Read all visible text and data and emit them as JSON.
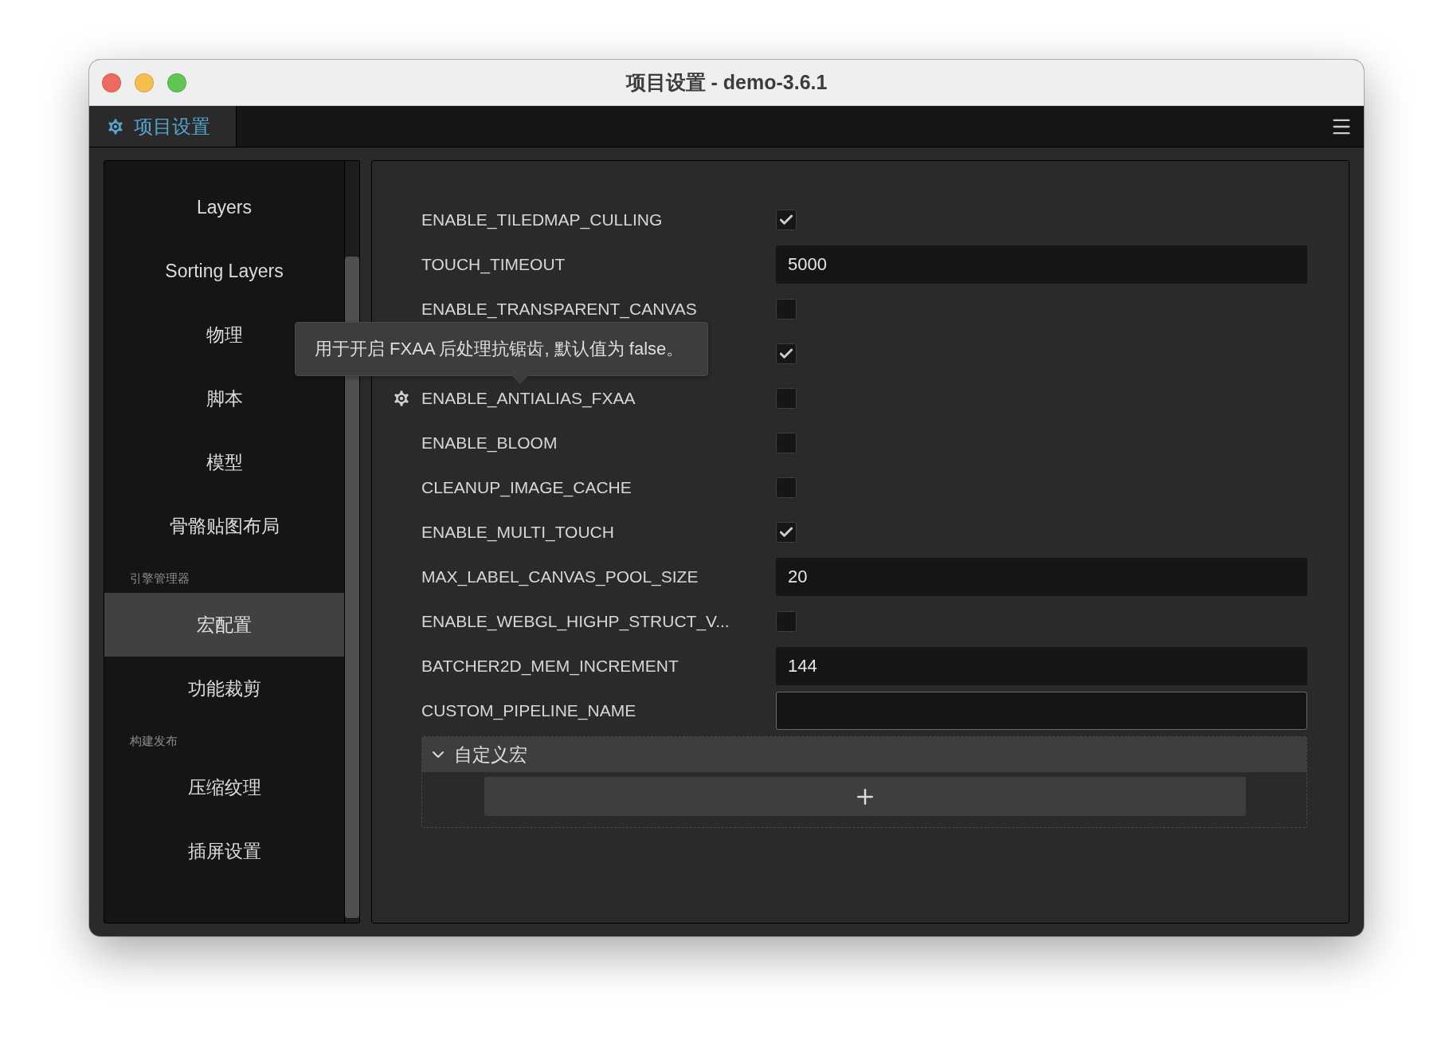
{
  "window": {
    "title": "项目设置 - demo-3.6.1"
  },
  "tabs": [
    {
      "label": "项目设置",
      "selected": true
    }
  ],
  "sidebar": {
    "items": [
      {
        "kind": "item",
        "label": "Layers",
        "selected": false
      },
      {
        "kind": "item",
        "label": "Sorting Layers",
        "selected": false
      },
      {
        "kind": "item",
        "label": "物理",
        "selected": false
      },
      {
        "kind": "item",
        "label": "脚本",
        "selected": false
      },
      {
        "kind": "item",
        "label": "模型",
        "selected": false
      },
      {
        "kind": "item",
        "label": "骨骼贴图布局",
        "selected": false
      },
      {
        "kind": "header",
        "label": "引擎管理器"
      },
      {
        "kind": "item",
        "label": "宏配置",
        "selected": true
      },
      {
        "kind": "item",
        "label": "功能裁剪",
        "selected": false
      },
      {
        "kind": "header",
        "label": "构建发布"
      },
      {
        "kind": "item",
        "label": "压缩纹理",
        "selected": false
      },
      {
        "kind": "item",
        "label": "插屏设置",
        "selected": false
      }
    ]
  },
  "settings": [
    {
      "kind": "checkbox",
      "label": "ENABLE_TILEDMAP_CULLING",
      "checked": true,
      "hovered": false
    },
    {
      "kind": "text",
      "label": "TOUCH_TIMEOUT",
      "value": "5000",
      "hovered": false
    },
    {
      "kind": "checkbox",
      "label": "ENABLE_TRANSPARENT_CANVAS",
      "checked": false,
      "hovered": false
    },
    {
      "kind": "checkbox",
      "checked": true,
      "hovered": false
    },
    {
      "kind": "checkbox",
      "label": "ENABLE_ANTIALIAS_FXAA",
      "checked": false,
      "hovered": true
    },
    {
      "kind": "checkbox",
      "label": "ENABLE_BLOOM",
      "checked": false,
      "hovered": false
    },
    {
      "kind": "checkbox",
      "label": "CLEANUP_IMAGE_CACHE",
      "checked": false,
      "hovered": false
    },
    {
      "kind": "checkbox",
      "label": "ENABLE_MULTI_TOUCH",
      "checked": true,
      "hovered": false
    },
    {
      "kind": "text",
      "label": "MAX_LABEL_CANVAS_POOL_SIZE",
      "value": "20",
      "hovered": false
    },
    {
      "kind": "checkbox",
      "label": "ENABLE_WEBGL_HIGHP_STRUCT_V...",
      "checked": false,
      "hovered": false
    },
    {
      "kind": "text",
      "label": "BATCHER2D_MEM_INCREMENT",
      "value": "144",
      "hovered": false
    },
    {
      "kind": "text",
      "label": "CUSTOM_PIPELINE_NAME",
      "hovered": false
    }
  ],
  "custom_macros": {
    "title": "自定义宏",
    "expanded": true
  },
  "tooltip": {
    "text": "用于开启 FXAA 后处理抗锯齿, 默认值为 false。"
  }
}
